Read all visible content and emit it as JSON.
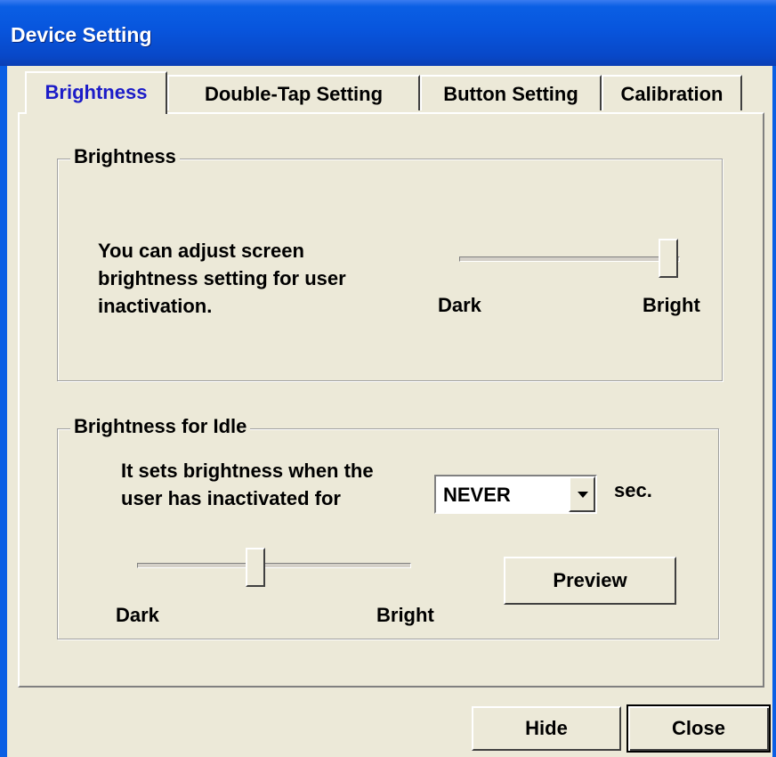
{
  "window": {
    "title": "Device Setting"
  },
  "tabs": [
    {
      "label": "Brightness",
      "active": true
    },
    {
      "label": "Double-Tap Setting",
      "active": false
    },
    {
      "label": "Button Setting",
      "active": false
    },
    {
      "label": "Calibration",
      "active": false
    }
  ],
  "brightness_group": {
    "title": "Brightness",
    "description_lines": [
      "You can adjust screen",
      "brightness setting for user",
      "inactivation."
    ],
    "slider": {
      "min_label": "Dark",
      "max_label": "Bright",
      "level": 1.0
    }
  },
  "idle_group": {
    "title": "Brightness for Idle",
    "description_lines": [
      "It sets brightness when the",
      "user has inactivated for"
    ],
    "timeout_select": {
      "value": "NEVER"
    },
    "unit": "sec.",
    "slider": {
      "min_label": "Dark",
      "max_label": "Bright",
      "level": 0.43
    },
    "preview_label": "Preview"
  },
  "footer": {
    "hide_label": "Hide",
    "close_label": "Close"
  },
  "colors": {
    "titlebar": "#0855dd",
    "active_tab_text": "#1c1cc8",
    "background": "#ece9d8"
  }
}
